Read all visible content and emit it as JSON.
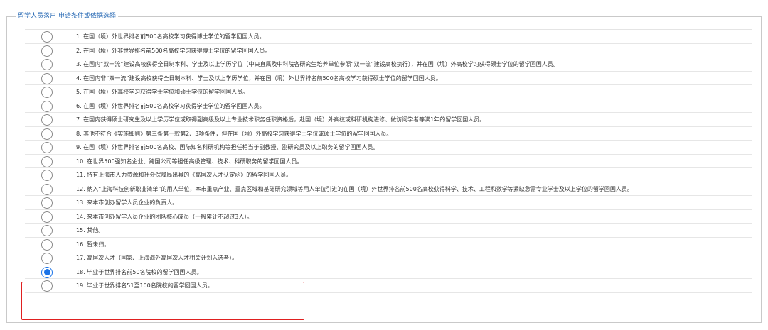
{
  "section": {
    "legend_part1": "留学人员落户",
    "legend_part2": "申请条件或依据选择"
  },
  "options": [
    {
      "label": "1. 在国（境）外世界排名前500名高校学习获得博士学位的留学回国人员。",
      "checked": false
    },
    {
      "label": "2. 在国（境）外非世界排名前500名高校学习获得博士学位的留学回国人员。",
      "checked": false
    },
    {
      "label": "3. 在国内“双一流”建设高校获得全日制本科、学士及以上学历学位（中央直属及中科院各研究生培养单位参照“双一流”建设高校执行），并在国（境）外高校学习获得硕士学位的留学回国人员。",
      "checked": false
    },
    {
      "label": "4. 在国内非“双一流”建设高校获得全日制本科、学士及以上学历学位，并在国（境）外世界排名前500名高校学习获得硕士学位的留学回国人员。",
      "checked": false
    },
    {
      "label": "5. 在国（境）外高校学习获得学士学位和硕士学位的留学回国人员。",
      "checked": false
    },
    {
      "label": "6. 在国（境）外世界排名前500名高校学习获得学士学位的留学回国人员。",
      "checked": false
    },
    {
      "label": "7. 在国内获得硕士研究生及以上学历学位或取得副高级及以上专业技术职务任职资格后，赴国（境）外高校或科研机构进修、做访问学者等满1年的留学回国人员。",
      "checked": false
    },
    {
      "label": "8. 其他不符合《实施细则》第三条第一款第2、3项条件，但在国（境）外高校学习获得学士学位或硕士学位的留学回国人员。",
      "checked": false
    },
    {
      "label": "9. 在国（境）外世界排名前500名高校、国际知名科研机构等担任相当于副教授、副研究员及以上职务的留学回国人员。",
      "checked": false
    },
    {
      "label": "10. 在世界500强知名企业、跨国公司等担任高级管理、技术、科研职务的留学回国人员。",
      "checked": false
    },
    {
      "label": "11. 持有上海市人力资源和社会保障局出具的《高层次人才认定函》的留学回国人员。",
      "checked": false
    },
    {
      "label": "12. 纳入“上海科技创新职业清单”的用人单位，本市重点产业、重点区域和基础研究领域等用人单位引进的在国（境）外世界排名前500名高校获得科学、技术、工程和数学等紧缺急需专业学士及以上学位的留学回国人员。",
      "checked": false
    },
    {
      "label": "13. 来本市创办留学人员企业的负责人。",
      "checked": false
    },
    {
      "label": "14. 来本市创办留学人员企业的团队核心成员（一般累计不超过3人）。",
      "checked": false
    },
    {
      "label": "15. 其他。",
      "checked": false
    },
    {
      "label": "16. 暂未归。",
      "checked": false
    },
    {
      "label": "17. 高层次人才（国家、上海海外高层次人才相关计划入选者）。",
      "checked": false
    },
    {
      "label": "18. 毕业于世界排名前50名院校的留学回国人员。",
      "checked": true
    },
    {
      "label": "19. 毕业于世界排名51至100名院校的留学回国人员。",
      "checked": false
    }
  ],
  "colors": {
    "legend": "#2a6bb5",
    "radio_checked": "#1a73e8",
    "highlight_box": "#e02020"
  }
}
